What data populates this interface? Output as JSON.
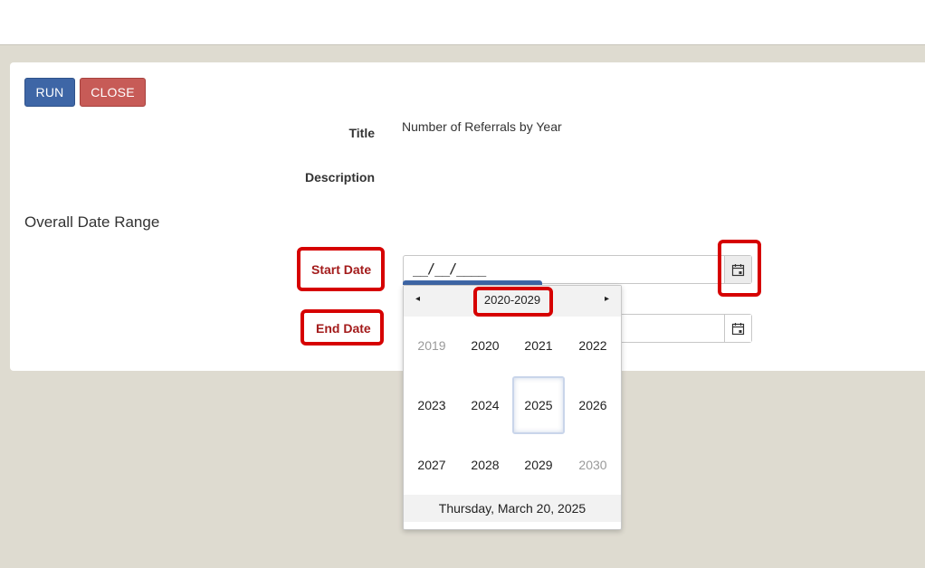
{
  "toolbar": {
    "run_label": "RUN",
    "close_label": "CLOSE"
  },
  "form": {
    "title_label": "Title",
    "title_value": "Number of Referrals by Year",
    "description_label": "Description",
    "section_heading": "Overall Date Range",
    "start_date_label": "Start Date",
    "start_date_value": "__/__/____",
    "end_date_label": "End Date"
  },
  "calendar": {
    "decade_label": "2020-2029",
    "prev_label": "◂",
    "next_label": "▸",
    "years": [
      {
        "label": "2019",
        "muted": true
      },
      {
        "label": "2020",
        "muted": false
      },
      {
        "label": "2021",
        "muted": false
      },
      {
        "label": "2022",
        "muted": false
      },
      {
        "label": "2023",
        "muted": false
      },
      {
        "label": "2024",
        "muted": false
      },
      {
        "label": "2025",
        "muted": false,
        "selected": true
      },
      {
        "label": "2026",
        "muted": false
      },
      {
        "label": "2027",
        "muted": false
      },
      {
        "label": "2028",
        "muted": false
      },
      {
        "label": "2029",
        "muted": false
      },
      {
        "label": "2030",
        "muted": true
      }
    ],
    "today_label": "Thursday, March 20, 2025"
  },
  "colors": {
    "accent": "#3e66a6",
    "danger": "#c75b57",
    "highlight": "#d60000"
  }
}
